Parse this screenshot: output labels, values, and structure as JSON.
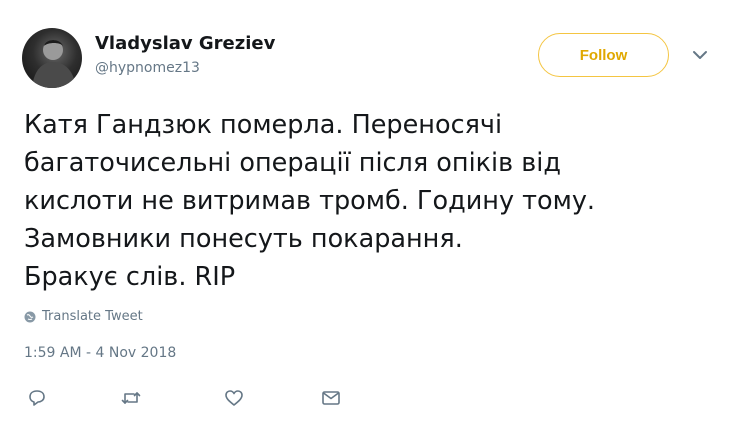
{
  "author": {
    "name": "Vladyslav Greziev",
    "handle": "@hypnomez13",
    "avatar_icon": "profile-photo"
  },
  "follow_button": {
    "label": "Follow",
    "color": "#e0a800",
    "border_color": "#f4c542"
  },
  "more_menu": {
    "icon": "chevron-down-icon"
  },
  "tweet": {
    "lines": [
      "Катя Гандзюк померла. Переносячі",
      "багаточисельні операції після опіків від",
      "кислоти не витримав тромб. Годину тому.",
      "Замовники понесуть покарання.",
      "Бракує слів. RIP"
    ]
  },
  "translate": {
    "label": "Translate Tweet",
    "icon": "globe-icon"
  },
  "timestamp": "1:59 AM - 4 Nov 2018",
  "actions": [
    {
      "name": "reply",
      "icon": "reply-icon"
    },
    {
      "name": "retweet",
      "icon": "retweet-icon"
    },
    {
      "name": "like",
      "icon": "heart-icon"
    },
    {
      "name": "direct-message",
      "icon": "envelope-icon"
    }
  ],
  "colors": {
    "text": "#14171a",
    "secondary": "#657786",
    "accent": "#e0a800"
  }
}
